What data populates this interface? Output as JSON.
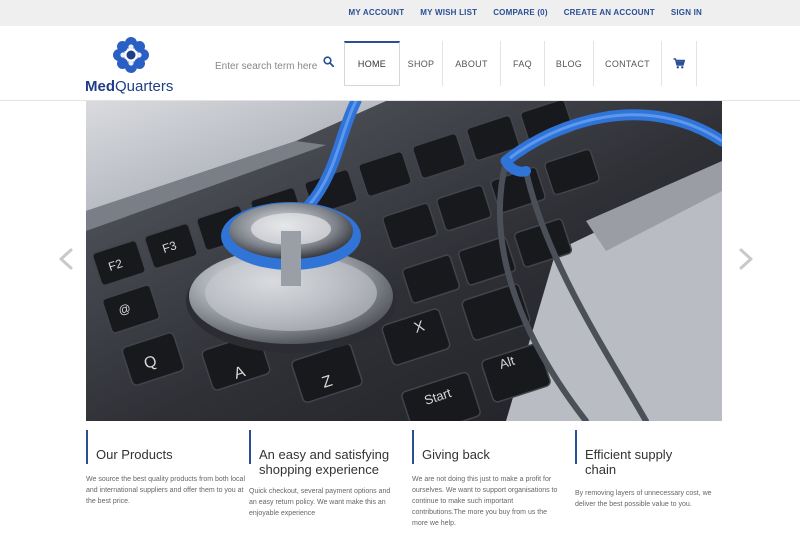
{
  "topbar": {
    "links": [
      "MY ACCOUNT",
      "MY WISH LIST",
      "COMPARE (0)",
      "CREATE AN ACCOUNT",
      "SIGN IN"
    ]
  },
  "logo": {
    "brand_prefix": "Med",
    "brand_suffix": "Quarters"
  },
  "search": {
    "placeholder": "Enter search term here"
  },
  "nav": {
    "items": [
      "HOME",
      "SHOP",
      "ABOUT",
      "FAQ",
      "BLOG",
      "CONTACT"
    ],
    "active": "HOME"
  },
  "hero": {
    "slides": 1
  },
  "features": [
    {
      "title": "Our Products",
      "text": "We source the best quality products from both local and international suppliers and offer them to you at the best price."
    },
    {
      "title": "An easy and satisfying shopping experience",
      "text": "Quick checkout, several payment options and an easy return policy. We want make this an enjoyable experience"
    },
    {
      "title": "Giving back",
      "text": "We are not doing this just to make a profit for ourselves. We want to support organisations to continue to make such important contributions.The more you buy from us the more we help."
    },
    {
      "title": "Efficient supply chain",
      "text": "By removing layers of unnecessary cost, we deliver the best possible value to you."
    }
  ],
  "colors": {
    "accent": "#2a4f96",
    "stethoscope": "#2f74d6"
  },
  "icons": [
    "search-icon",
    "cart-icon",
    "chevron-left-icon",
    "chevron-right-icon",
    "logo-flower-icon"
  ]
}
